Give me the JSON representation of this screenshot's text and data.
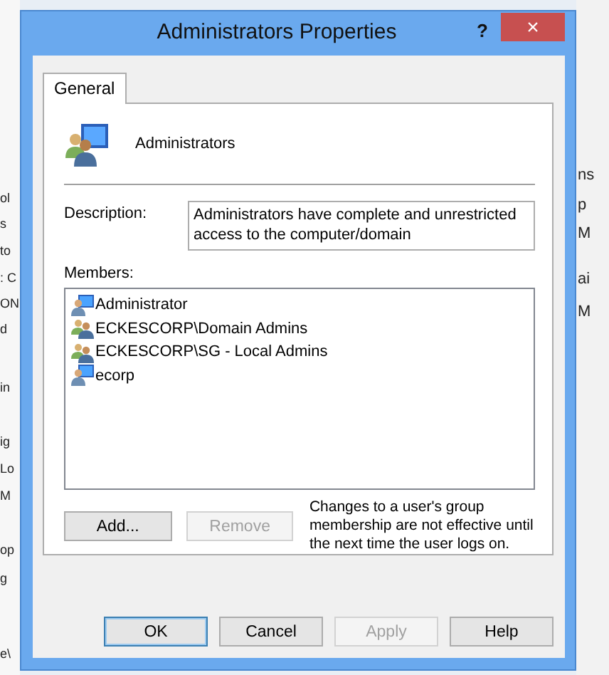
{
  "background_left": [
    "ol",
    "s",
    "to",
    ": C",
    "ON",
    "d",
    "in",
    "ig",
    "Lo",
    "M",
    "op",
    "g",
    "e\\"
  ],
  "background_right": [
    "ns",
    "p",
    "M",
    "ai",
    "M"
  ],
  "window": {
    "title": "Administrators Properties",
    "help": "?",
    "close": "×"
  },
  "tabs": [
    {
      "label": "General",
      "selected": true
    }
  ],
  "group": {
    "name": "Administrators"
  },
  "description": {
    "label": "Description:",
    "value": "Administrators have complete and unrestricted access to the computer/domain"
  },
  "members": {
    "label": "Members:",
    "items": [
      {
        "name": "Administrator",
        "kind": "user"
      },
      {
        "name": "ECKESCORP\\Domain Admins",
        "kind": "group"
      },
      {
        "name": "ECKESCORP\\SG - Local Admins",
        "kind": "group"
      },
      {
        "name": "ecorp",
        "kind": "user"
      }
    ]
  },
  "member_buttons": [
    {
      "label": "Add...",
      "disabled": false
    },
    {
      "label": "Remove",
      "disabled": true
    }
  ],
  "note": "Changes to a user's group membership are not effective until the next time the user logs on.",
  "buttons": [
    {
      "label": "OK",
      "default": true,
      "disabled": false
    },
    {
      "label": "Cancel",
      "default": false,
      "disabled": false
    },
    {
      "label": "Apply",
      "default": false,
      "disabled": true
    },
    {
      "label": "Help",
      "default": false,
      "disabled": false
    }
  ]
}
